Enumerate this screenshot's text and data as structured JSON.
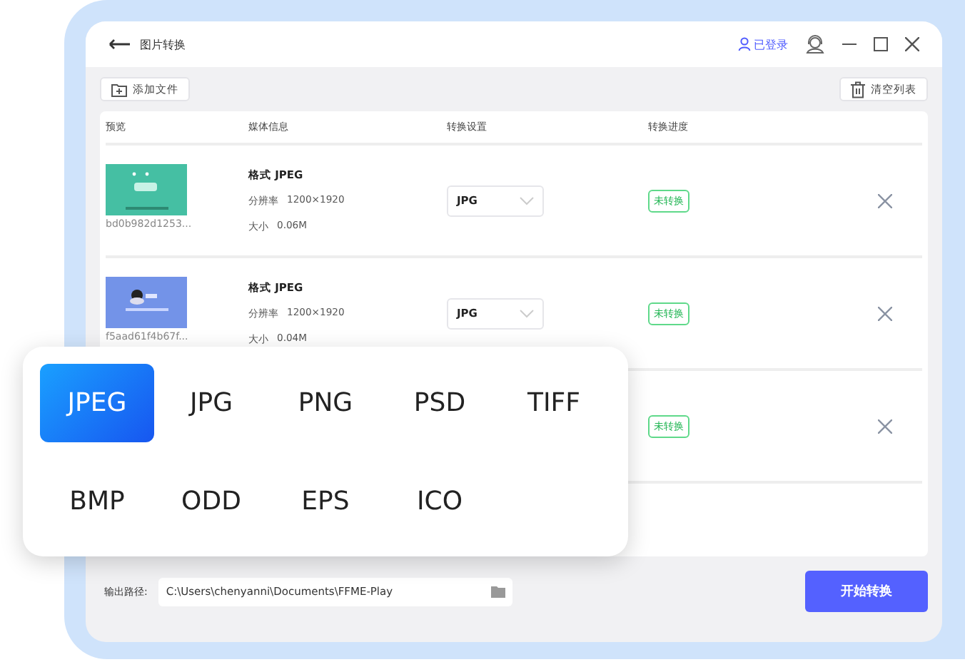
{
  "window": {
    "title": "图片转换",
    "user": "已登录"
  },
  "toolbar": {
    "add": "添加文件",
    "clear": "清空列表"
  },
  "table": {
    "columns": [
      "预览",
      "媒体信息",
      "转换设置",
      "转换进度"
    ],
    "rows": [
      {
        "kind": "full",
        "filename": "bd0b982d1253...",
        "format": "格式  JPEG",
        "resolution_label": "分辨率",
        "resolution": "1200×1920",
        "size_label": "大小",
        "size": "0.06M",
        "setting": "JPG",
        "status": "未转换"
      },
      {
        "kind": "full",
        "filename": "f5aad61f4b67f...",
        "format": "格式  JPEG",
        "resolution_label": "分辨率",
        "resolution": "1200×1920",
        "size_label": "大小",
        "size": "0.04M",
        "setting": "JPG",
        "status": "未转换"
      },
      {
        "kind": "covered",
        "status": "未转换"
      }
    ]
  },
  "output": {
    "label": "输出路径:",
    "path": "C:\\Users\\chenyanni\\Documents\\FFME-Play"
  },
  "start_button": "开始转换",
  "format_popup": {
    "options": [
      {
        "label": "JPEG",
        "selected": true
      },
      {
        "label": "JPG",
        "selected": false
      },
      {
        "label": "PNG",
        "selected": false
      },
      {
        "label": "PSD",
        "selected": false
      },
      {
        "label": "TIFF",
        "selected": false
      },
      {
        "label": "BMP",
        "selected": false
      },
      {
        "label": "ODD",
        "selected": false
      },
      {
        "label": "EPS",
        "selected": false
      },
      {
        "label": "ICO",
        "selected": false
      }
    ]
  }
}
